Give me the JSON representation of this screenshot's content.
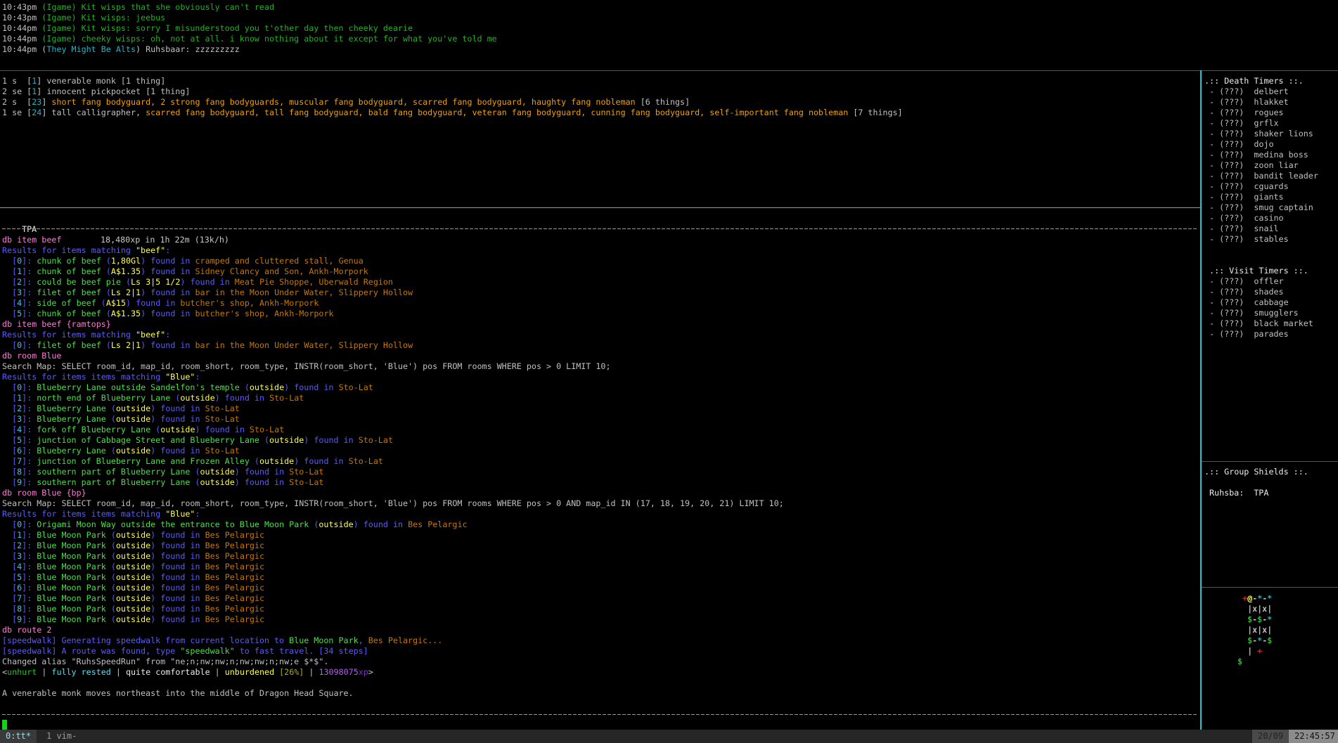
{
  "colors": {
    "w": "#c0c0c0",
    "W": "#ececec",
    "g": "#22b022",
    "C": "#1fb4c4",
    "O": "#f0a000",
    "p": "#ff78d8",
    "b": "#5a5aff",
    "c": "#38c8e8",
    "G": "#48e048",
    "y": "#ffff48",
    "o": "#c87800",
    "Y": "#a8a828",
    "P": "#b060f0",
    "P2": "#8030c8",
    "L": "#50e0f0",
    "U": "#20c020",
    "r": "#e02020",
    "cursor": "#00e000",
    "sep": "#22c8d8",
    "grey_sep": "#555555"
  },
  "chat": [
    [
      [
        "10:43pm ",
        "w"
      ],
      [
        "(Igame) Kit wisps that she obviously can't read",
        "g"
      ]
    ],
    [
      [
        "10:43pm ",
        "w"
      ],
      [
        "(Igame) Kit wisps: jeebus",
        "g"
      ]
    ],
    [
      [
        "10:44pm ",
        "w"
      ],
      [
        "(Igame) Kit wisps: sorry I misunderstood you t'other day then cheeky dearie",
        "g"
      ]
    ],
    [
      [
        "10:44pm ",
        "w"
      ],
      [
        "(Igame) cheeky wisps: oh, not at all. i know nothing about it except for what you've told me",
        "g"
      ]
    ],
    [
      [
        "10:44pm (",
        "w"
      ],
      [
        "They Might Be Alts",
        "C"
      ],
      [
        ") Ruhsbaar: zzzzzzzzz",
        "w"
      ]
    ]
  ],
  "rooms": [
    [
      [
        "1 s  [",
        "w"
      ],
      [
        "1",
        "C"
      ],
      [
        "] venerable monk [1 thing]",
        "w"
      ]
    ],
    [
      [
        "2 se [",
        "w"
      ],
      [
        "1",
        "C"
      ],
      [
        "] innocent pickpocket [1 thing]",
        "w"
      ]
    ],
    [
      [
        "2 s  [",
        "w"
      ],
      [
        "23",
        "C"
      ],
      [
        "] ",
        "w"
      ],
      [
        "short fang bodyguard, 2 strong fang bodyguards, muscular fang bodyguard, scarred fang bodyguard, haughty fang nobleman",
        "O"
      ],
      [
        " [6 things]",
        "w"
      ]
    ],
    [
      [
        "1 se [",
        "w"
      ],
      [
        "24",
        "C"
      ],
      [
        "] tall calligrapher, ",
        "w"
      ],
      [
        "scarred fang bodyguard, tall fang bodyguard, bald fang bodyguard, veteran fang bodyguard, cunning fang bodyguard, self-important fang nobleman",
        "O"
      ],
      [
        " [7 things]",
        "w"
      ]
    ]
  ],
  "xp_bar": {
    "name": "TPA",
    "rate": "18,480xp in 1h 22m (13k/h)"
  },
  "main": [
    {
      "t": "cmd",
      "text": "db item beef"
    },
    {
      "t": "results",
      "prefix": "Results for items matching ",
      "term": "\"beef\"",
      "suffix": ":"
    },
    {
      "t": "item",
      "idx": "0",
      "name": "chunk of beef",
      "price": "1,80Gl",
      "found": "found in",
      "loc": "cramped and cluttered stall, Genua"
    },
    {
      "t": "item",
      "idx": "1",
      "name": "chunk of beef",
      "price": "A$1.35",
      "found": "found in",
      "loc": "Sidney Clancy and Son, Ankh-Morpork"
    },
    {
      "t": "item",
      "idx": "2",
      "name": "could be beef pie",
      "price": "Ls 3|5 1/2",
      "found": "found in",
      "loc": "Meat Pie Shoppe, Uberwald Region"
    },
    {
      "t": "item",
      "idx": "3",
      "name": "filet of beef",
      "price": "Ls 2|1",
      "found": "found in",
      "loc": "bar in the Moon Under Water, Slippery Hollow"
    },
    {
      "t": "item",
      "idx": "4",
      "name": "side of beef",
      "price": "A$15",
      "found": "found in",
      "loc": "butcher's shop, Ankh-Morpork"
    },
    {
      "t": "item",
      "idx": "5",
      "name": "chunk of beef",
      "price": "A$1.35",
      "found": "found in",
      "loc": "butcher's shop, Ankh-Morpork"
    },
    {
      "t": "cmd",
      "text": "db item beef {ramtops}"
    },
    {
      "t": "results",
      "prefix": "Results for items matching ",
      "term": "\"beef\"",
      "suffix": ":"
    },
    {
      "t": "item",
      "idx": "0",
      "name": "filet of beef",
      "price": "Ls 2|1",
      "found": "found in",
      "loc": "bar in the Moon Under Water, Slippery Hollow"
    },
    {
      "t": "cmd",
      "text": "db room Blue"
    },
    {
      "t": "plain",
      "text": "Search Map: SELECT room_id, map_id, room_short, room_type, INSTR(room_short, 'Blue') pos FROM rooms WHERE pos > 0 LIMIT 10;"
    },
    {
      "t": "results",
      "prefix": "Results for items items matching ",
      "term": "\"Blue\"",
      "suffix": ":"
    },
    {
      "t": "item",
      "idx": "0",
      "name": "Blueberry Lane outside Sandelfon's temple",
      "price": "outside",
      "found": "found in",
      "loc": "Sto-Lat"
    },
    {
      "t": "item",
      "idx": "1",
      "name": "north end of Blueberry Lane",
      "price": "outside",
      "found": "found in",
      "loc": "Sto-Lat"
    },
    {
      "t": "item",
      "idx": "2",
      "name": "Blueberry Lane",
      "price": "outside",
      "found": "found in",
      "loc": "Sto-Lat"
    },
    {
      "t": "item",
      "idx": "3",
      "name": "Blueberry Lane",
      "price": "outside",
      "found": "found in",
      "loc": "Sto-Lat"
    },
    {
      "t": "item",
      "idx": "4",
      "name": "fork off Blueberry Lane",
      "price": "outside",
      "found": "found in",
      "loc": "Sto-Lat"
    },
    {
      "t": "item",
      "idx": "5",
      "name": "junction of Cabbage Street and Blueberry Lane",
      "price": "outside",
      "found": "found in",
      "loc": "Sto-Lat"
    },
    {
      "t": "item",
      "idx": "6",
      "name": "Blueberry Lane",
      "price": "outside",
      "found": "found in",
      "loc": "Sto-Lat"
    },
    {
      "t": "item",
      "idx": "7",
      "name": "junction of Blueberry Lane and Frozen Alley",
      "price": "outside",
      "found": "found in",
      "loc": "Sto-Lat"
    },
    {
      "t": "item",
      "idx": "8",
      "name": "southern part of Blueberry Lane",
      "price": "outside",
      "found": "found in",
      "loc": "Sto-Lat"
    },
    {
      "t": "item",
      "idx": "9",
      "name": "southern part of Blueberry Lane",
      "price": "outside",
      "found": "found in",
      "loc": "Sto-Lat"
    },
    {
      "t": "cmd",
      "text": "db room Blue {bp}"
    },
    {
      "t": "plain",
      "text": "Search Map: SELECT room_id, map_id, room_short, room_type, INSTR(room_short, 'Blue') pos FROM rooms WHERE pos > 0 AND map_id IN (17, 18, 19, 20, 21) LIMIT 10;"
    },
    {
      "t": "results",
      "prefix": "Results for items items matching ",
      "term": "\"Blue\"",
      "suffix": ":"
    },
    {
      "t": "item",
      "idx": "0",
      "name": "Origami Moon Way outside the entrance to Blue Moon Park",
      "price": "outside",
      "found": "found in",
      "loc": "Bes Pelargic"
    },
    {
      "t": "item",
      "idx": "1",
      "name": "Blue Moon Park",
      "price": "outside",
      "found": "found in",
      "loc": "Bes Pelargic"
    },
    {
      "t": "item",
      "idx": "2",
      "name": "Blue Moon Park",
      "price": "outside",
      "found": "found in",
      "loc": "Bes Pelargic"
    },
    {
      "t": "item",
      "idx": "3",
      "name": "Blue Moon Park",
      "price": "outside",
      "found": "found in",
      "loc": "Bes Pelargic"
    },
    {
      "t": "item",
      "idx": "4",
      "name": "Blue Moon Park",
      "price": "outside",
      "found": "found in",
      "loc": "Bes Pelargic"
    },
    {
      "t": "item",
      "idx": "5",
      "name": "Blue Moon Park",
      "price": "outside",
      "found": "found in",
      "loc": "Bes Pelargic"
    },
    {
      "t": "item",
      "idx": "6",
      "name": "Blue Moon Park",
      "price": "outside",
      "found": "found in",
      "loc": "Bes Pelargic"
    },
    {
      "t": "item",
      "idx": "7",
      "name": "Blue Moon Park",
      "price": "outside",
      "found": "found in",
      "loc": "Bes Pelargic"
    },
    {
      "t": "item",
      "idx": "8",
      "name": "Blue Moon Park",
      "price": "outside",
      "found": "found in",
      "loc": "Bes Pelargic"
    },
    {
      "t": "item",
      "idx": "9",
      "name": "Blue Moon Park",
      "price": "outside",
      "found": "found in",
      "loc": "Bes Pelargic"
    },
    {
      "t": "cmd",
      "text": "db route 2"
    },
    {
      "t": "segs",
      "segs": [
        [
          "[speedwalk] Generating speedwalk from current location to ",
          "b"
        ],
        [
          "Blue Moon Park",
          "G"
        ],
        [
          ", ",
          "b"
        ],
        [
          "Bes Pelargic...",
          "o"
        ]
      ]
    },
    {
      "t": "segs",
      "segs": [
        [
          "[speedwalk] A route was found, type ",
          "b"
        ],
        [
          "\"speedwalk\"",
          "G"
        ],
        [
          " to fast travel. [34 steps]",
          "b"
        ]
      ]
    },
    {
      "t": "plain",
      "text": "Changed alias \"RuhsSpeedRun\" from \"ne;n;nw;nw;n;nw;nw;n;nw;e $*$\"."
    },
    {
      "t": "segs",
      "segs": [
        [
          "<",
          "w"
        ],
        [
          "unhurt",
          "U"
        ],
        [
          " | ",
          "w"
        ],
        [
          "fully rested",
          "L"
        ],
        [
          " | ",
          "w"
        ],
        [
          "quite comfortable",
          "W"
        ],
        [
          " | ",
          "w"
        ],
        [
          "unburdened ",
          "y"
        ],
        [
          "[26%]",
          "Y"
        ],
        [
          " | ",
          "w"
        ],
        [
          "13098075",
          "P"
        ],
        [
          "xp",
          "P2"
        ],
        [
          ">",
          "w"
        ]
      ]
    },
    {
      "t": "plain",
      "text": ""
    },
    {
      "t": "plain",
      "text": "A venerable monk moves northeast into the middle of Dragon Head Square."
    }
  ],
  "side": {
    "death_title": ".:: Death Timers ::.",
    "death": [
      "delbert",
      "hlakket",
      "rogues",
      "grflx",
      "shaker lions",
      "dojo",
      "medina boss",
      "zoon liar",
      "bandit leader",
      "cguards",
      "giants",
      "smug captain",
      "casino",
      "snail",
      "stables"
    ],
    "timer_prefix": " - (???)  ",
    "visit_title": " .:: Visit Timers ::.",
    "visit": [
      "offler",
      "shades",
      "cabbage",
      "smugglers",
      "black market",
      "parades"
    ],
    "shields_title": ".:: Group Shields ::.",
    "shields": [
      {
        "name": "Ruhsba:",
        "value": "TPA"
      }
    ]
  },
  "map": [
    [
      [
        " ",
        "w"
      ],
      [
        "+",
        "r"
      ],
      [
        "@",
        "y"
      ],
      [
        "-",
        "w"
      ],
      [
        "*",
        "C"
      ],
      [
        "-",
        "w"
      ],
      [
        "*",
        "C"
      ]
    ],
    [
      [
        "  |x|x|",
        "w"
      ]
    ],
    [
      [
        "  ",
        "w"
      ],
      [
        "$",
        "U"
      ],
      [
        "-",
        "w"
      ],
      [
        "$",
        "U"
      ],
      [
        "-",
        "w"
      ],
      [
        "*",
        "C"
      ]
    ],
    [
      [
        "  |x|x|",
        "w"
      ]
    ],
    [
      [
        "  ",
        "w"
      ],
      [
        "$",
        "U"
      ],
      [
        "-",
        "w"
      ],
      [
        "*",
        "C"
      ],
      [
        "-",
        "w"
      ],
      [
        "$",
        "U"
      ]
    ],
    [
      [
        "  | ",
        "w"
      ],
      [
        "+",
        "r"
      ]
    ],
    [
      [
        "$",
        "U"
      ]
    ]
  ],
  "statusbar": {
    "windows": [
      {
        "label": "0:tt*",
        "active": true
      },
      {
        "label": "1 vim-",
        "active": false
      }
    ],
    "date": "20/09",
    "time": "22:45:57"
  }
}
